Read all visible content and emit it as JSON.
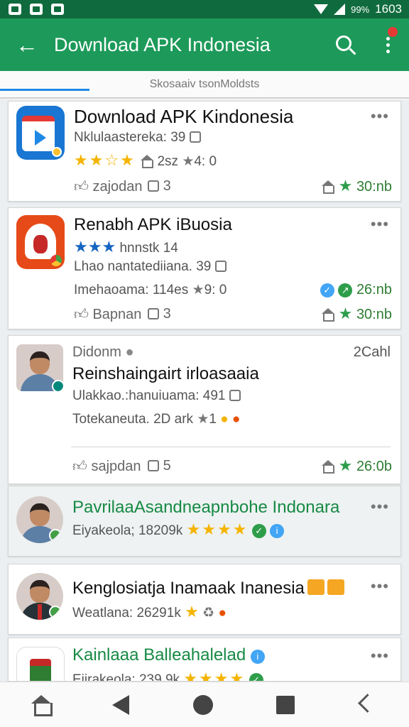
{
  "status_bar": {
    "battery": "99%",
    "time": "1603"
  },
  "app_bar": {
    "title": "Download APK Indonesia",
    "back_icon": "arrow-left-icon",
    "search_icon": "search-icon",
    "more_icon": "more-vert-icon"
  },
  "tabs": {
    "label": "Skosaaiv tsonMoldsts"
  },
  "cards": [
    {
      "title": "Download APK Kindonesia",
      "subtitle": "Nklulaastereka: 39",
      "rating_extra": "2sz",
      "rating_extra2": "4: 0",
      "like_label": "zajodan",
      "comment_count": "3",
      "size": "30:nb",
      "stars": 3.5,
      "icon": "video-player-app-icon"
    },
    {
      "title": "Renabh APK iBuosia",
      "subtitle": "hnnstk 14",
      "line2": "Lhao nantatediiana. 39",
      "line3": "Imehaoama: 114es",
      "line3b": "9: 0",
      "size_small": "26:nb",
      "like_label": "Bapnan",
      "comment_count": "3",
      "size": "30:nb",
      "icon": "chat-bubble-app-icon"
    },
    {
      "author": "Didonm",
      "time": "2Cahl",
      "title": "Reinshaingairt irloasaaia",
      "line2": "Ulakkao.:hanuiuama: 491",
      "line3": "Totekaneuta. 2D ark",
      "line3b": "1",
      "like_label": "sajpdan",
      "comment_count": "5",
      "size": "26:0b",
      "icon": "author-avatar"
    },
    {
      "title": "PavrilaaAsandneapnbohe Indonara",
      "subtitle": "Eiyakeola; 18209k",
      "stars": 4,
      "icon": "author-avatar"
    },
    {
      "title": "Kenglosiatja Inamaak Inanesia",
      "subtitle": "Weatlana: 26291k",
      "stars": 1,
      "icon": "author-avatar"
    },
    {
      "title": "Kainlaaa Balleahalelad",
      "subtitle": "Eiirakeola: 239 9k",
      "stars": 4,
      "icon": "jar-app-icon"
    }
  ],
  "nav_bar": {
    "items": [
      "home-icon",
      "back-icon",
      "home-circle-icon",
      "recents-icon",
      "share-icon"
    ]
  },
  "colors": {
    "primary": "#1d9a5a",
    "status_bar": "#0f6b3d",
    "star": "#f4b400",
    "accent_green": "#2e9d4a",
    "tab_indicator": "#1e88e5"
  }
}
